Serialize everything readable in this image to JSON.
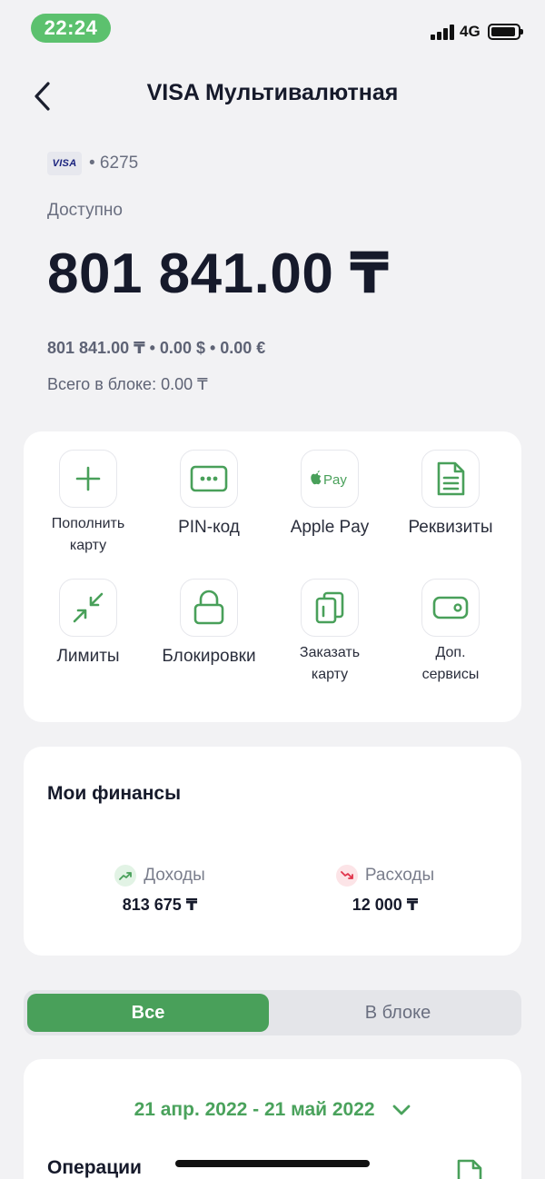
{
  "status_bar": {
    "time": "22:24",
    "network": "4G"
  },
  "header": {
    "title": "VISA Мультивалютная"
  },
  "card": {
    "brand": "VISA",
    "number": "• 6275",
    "available_label": "Доступно",
    "balance": "801 841.00 ₸",
    "sub_balances": "801 841.00 ₸ • 0.00 $ • 0.00 €",
    "blocked_total": "Всего в блоке: 0.00 ₸"
  },
  "actions": [
    {
      "label": "Пополнить карту",
      "icon": "plus-icon"
    },
    {
      "label": "PIN-код",
      "icon": "pin-icon"
    },
    {
      "label": "Apple Pay",
      "icon": "apple-pay-icon"
    },
    {
      "label": "Реквизиты",
      "icon": "document-icon"
    },
    {
      "label": "Лимиты",
      "icon": "limits-icon"
    },
    {
      "label": "Блокировки",
      "icon": "lock-icon"
    },
    {
      "label": "Заказать карту",
      "icon": "cards-icon"
    },
    {
      "label": "Доп. сервисы",
      "icon": "wallet-icon"
    }
  ],
  "action_labels": {
    "topup_line1": "Пополнить",
    "topup_line2": "карту",
    "order_line1": "Заказать",
    "order_line2": "карту",
    "extra_line1": "Доп.",
    "extra_line2": "сервисы",
    "apple_pay_glyph": "Pay"
  },
  "finances": {
    "title": "Мои финансы",
    "income_label": "Доходы",
    "income_value": "813 675 ₸",
    "expense_label": "Расходы",
    "expense_value": "12 000 ₸"
  },
  "filter": {
    "all_label": "Все",
    "blocked_label": "В блоке",
    "selected": "Все"
  },
  "operations": {
    "date_range": "21 апр. 2022 - 21 май 2022",
    "title": "Операции"
  },
  "colors": {
    "accent": "#49a05a",
    "status_pill": "#5cc16e",
    "expense": "#e0344b"
  }
}
